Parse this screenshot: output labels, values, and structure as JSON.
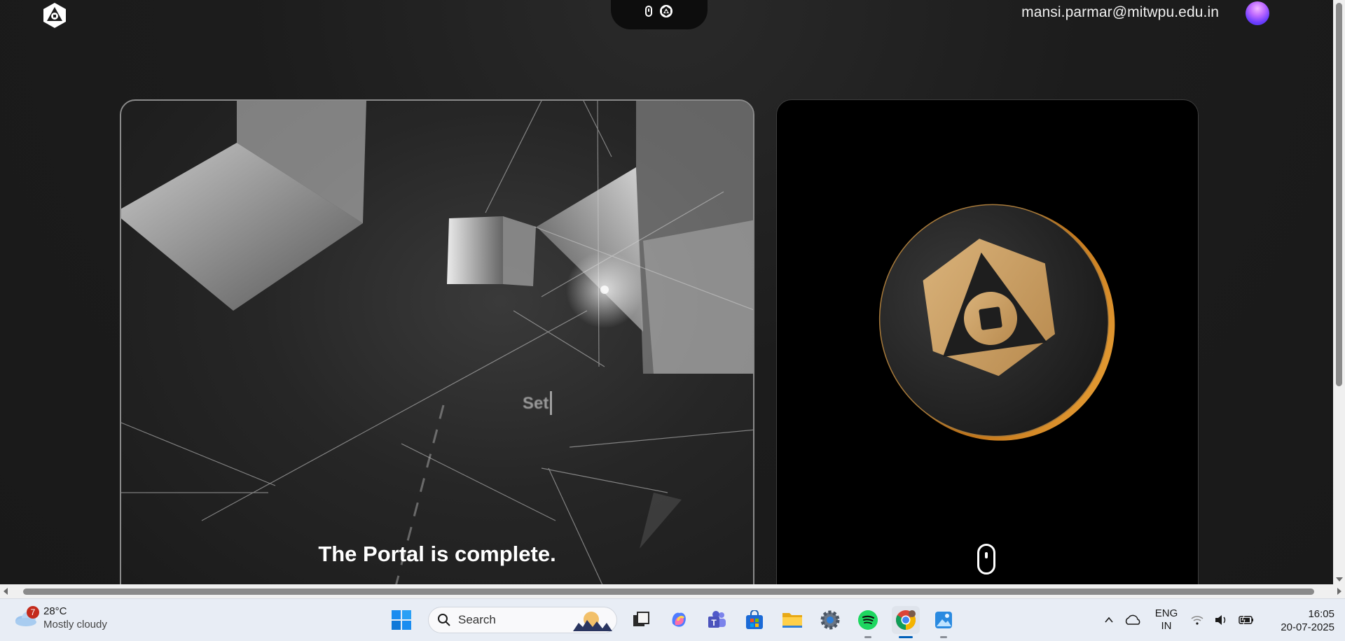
{
  "header": {
    "user_email": "mansi.parmar@mitwpu.edu.in"
  },
  "hero": {
    "caption": "The Portal is complete.",
    "overlay_text": "Set"
  },
  "taskbar": {
    "weather": {
      "badge": "7",
      "temperature": "28°C",
      "condition": "Mostly cloudy"
    },
    "search_placeholder": "Search",
    "apps": [
      "windows-start",
      "task-view",
      "copilot",
      "teams",
      "microsoft-store",
      "file-explorer",
      "settings",
      "spotify",
      "chrome",
      "photos"
    ],
    "language_line1": "ENG",
    "language_line2": "IN",
    "time": "16:05",
    "date": "20-07-2025"
  },
  "colors": {
    "page_bg": "#1b1b1b",
    "coin_gold": "#c9a063",
    "accent_blue": "#005fb8"
  }
}
